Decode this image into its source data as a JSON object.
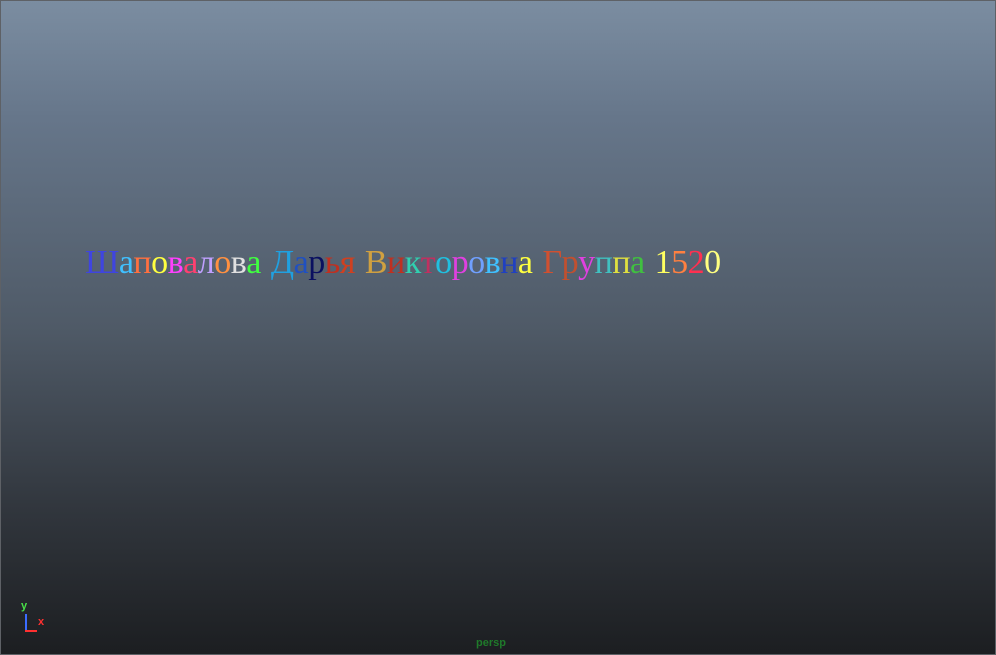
{
  "scene": {
    "words": [
      {
        "letters": [
          {
            "ch": "Ш",
            "color": "#3f45e0"
          },
          {
            "ch": "а",
            "color": "#40c0ff"
          },
          {
            "ch": "п",
            "color": "#ff7040"
          },
          {
            "ch": "о",
            "color": "#ffff40"
          },
          {
            "ch": "в",
            "color": "#ff40ff"
          },
          {
            "ch": "а",
            "color": "#ff4070"
          },
          {
            "ch": "л",
            "color": "#c0a0ff"
          },
          {
            "ch": "о",
            "color": "#ff9040"
          },
          {
            "ch": "в",
            "color": "#e0e0e0"
          },
          {
            "ch": "а",
            "color": "#40ff40"
          }
        ]
      },
      {
        "letters": [
          {
            "ch": "Д",
            "color": "#20a0e0"
          },
          {
            "ch": "а",
            "color": "#2050c0"
          },
          {
            "ch": "р",
            "color": "#0a1060"
          },
          {
            "ch": "ь",
            "color": "#c03020"
          },
          {
            "ch": "я",
            "color": "#d04020"
          }
        ]
      },
      {
        "letters": [
          {
            "ch": "В",
            "color": "#d0a040"
          },
          {
            "ch": "и",
            "color": "#c03020"
          },
          {
            "ch": "к",
            "color": "#30d0b0"
          },
          {
            "ch": "т",
            "color": "#c03060"
          },
          {
            "ch": "о",
            "color": "#20c0e0"
          },
          {
            "ch": "р",
            "color": "#e040e0"
          },
          {
            "ch": "о",
            "color": "#70a0ff"
          },
          {
            "ch": "в",
            "color": "#40c0ff"
          },
          {
            "ch": "н",
            "color": "#2040c0"
          },
          {
            "ch": "а",
            "color": "#ffff40"
          }
        ]
      },
      {
        "letters": [
          {
            "ch": "Г",
            "color": "#d05030"
          },
          {
            "ch": "р",
            "color": "#c05030"
          },
          {
            "ch": "у",
            "color": "#e040e0"
          },
          {
            "ch": "п",
            "color": "#40c0c0"
          },
          {
            "ch": "п",
            "color": "#e0e040"
          },
          {
            "ch": "а",
            "color": "#40c040"
          }
        ]
      },
      {
        "letters": [
          {
            "ch": "1",
            "color": "#ffff60"
          },
          {
            "ch": "5",
            "color": "#ff8040"
          },
          {
            "ch": "2",
            "color": "#ff3050"
          },
          {
            "ch": "0",
            "color": "#ffff80"
          }
        ]
      }
    ]
  },
  "axis_gizmo": {
    "y_label": "y",
    "x_label": "x"
  },
  "camera_label": "persp"
}
